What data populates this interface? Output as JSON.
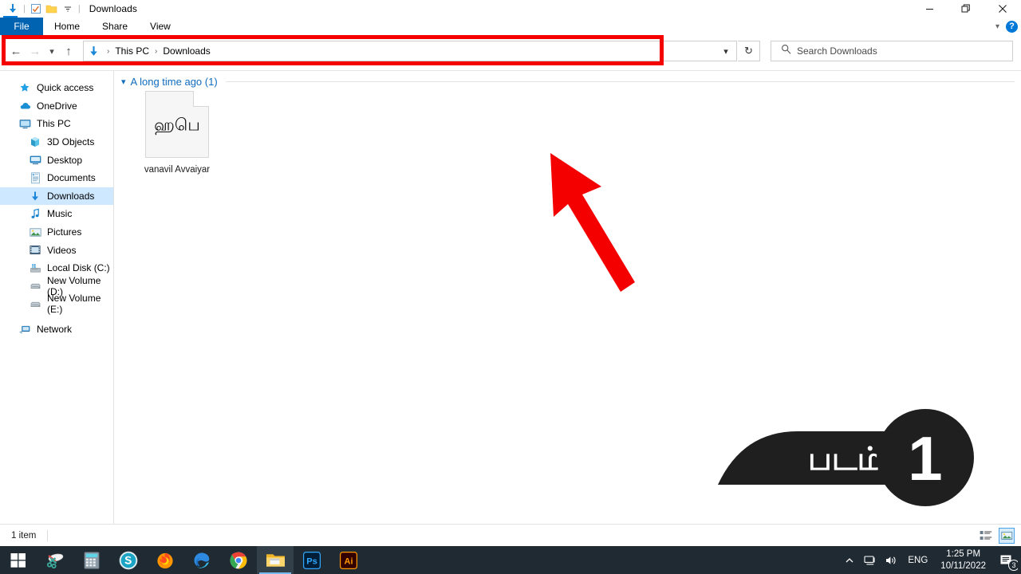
{
  "window": {
    "title": "Downloads",
    "quick_access_icons": [
      "download-arrow-icon",
      "properties-checkbox-icon",
      "new-folder-icon",
      "customize-chevron-icon"
    ],
    "controls": {
      "minimize": "─",
      "restore": "❐",
      "close": "✕"
    }
  },
  "ribbon": {
    "tabs": [
      {
        "label": "File",
        "active": true
      },
      {
        "label": "Home",
        "active": false
      },
      {
        "label": "Share",
        "active": false
      },
      {
        "label": "View",
        "active": false
      }
    ],
    "collapse_icon": "ˇ",
    "help_label": "?"
  },
  "navigation": {
    "back_icon": "←",
    "forward_icon": "→",
    "recent_icon": "ˇ",
    "up_icon": "↑",
    "breadcrumbs": [
      "This PC",
      "Downloads"
    ],
    "breadcrumb_sep": "›",
    "dropdown_icon": "ˇ",
    "refresh_icon": "↻"
  },
  "search": {
    "placeholder": "Search Downloads",
    "icon": "search-icon"
  },
  "sidebar": {
    "items": [
      {
        "label": "Quick access",
        "icon": "star-icon",
        "level": 0,
        "selected": false
      },
      {
        "label": "OneDrive",
        "icon": "cloud-icon",
        "level": 0,
        "selected": false
      },
      {
        "label": "This PC",
        "icon": "monitor-icon",
        "level": 0,
        "selected": false
      },
      {
        "label": "3D Objects",
        "icon": "cube-icon",
        "level": 1,
        "selected": false
      },
      {
        "label": "Desktop",
        "icon": "desktop-icon",
        "level": 1,
        "selected": false
      },
      {
        "label": "Documents",
        "icon": "documents-icon",
        "level": 1,
        "selected": false
      },
      {
        "label": "Downloads",
        "icon": "download-arrow-icon",
        "level": 1,
        "selected": true
      },
      {
        "label": "Music",
        "icon": "music-note-icon",
        "level": 1,
        "selected": false
      },
      {
        "label": "Pictures",
        "icon": "picture-icon",
        "level": 1,
        "selected": false
      },
      {
        "label": "Videos",
        "icon": "video-icon",
        "level": 1,
        "selected": false
      },
      {
        "label": "Local Disk (C:)",
        "icon": "system-drive-icon",
        "level": 1,
        "selected": false
      },
      {
        "label": "New Volume (D:)",
        "icon": "drive-icon",
        "level": 1,
        "selected": false
      },
      {
        "label": "New Volume (E:)",
        "icon": "drive-icon",
        "level": 1,
        "selected": false
      },
      {
        "label": "Network",
        "icon": "network-icon",
        "level": 0,
        "selected": false
      }
    ]
  },
  "main": {
    "group": {
      "chevron": "⌄",
      "label": "A long time ago (1)"
    },
    "files": [
      {
        "name": "vanavil Avvaiyar",
        "preview_text": "ஹபெ",
        "icon": "font-file-icon"
      }
    ]
  },
  "annotations": {
    "arrow": {
      "color": "#f40000",
      "name": "red-pointer-arrow"
    },
    "highlight_box": {
      "color": "#f40000",
      "name": "address-bar-highlight"
    },
    "badge": {
      "text": "படம்",
      "number": "1",
      "color": "#1f1f1f"
    }
  },
  "status": {
    "item_count": "1 item",
    "views": [
      {
        "name": "details-view",
        "active": false
      },
      {
        "name": "large-icons-view",
        "active": true
      }
    ]
  },
  "taskbar": {
    "items": [
      {
        "name": "start-button",
        "active": false
      },
      {
        "name": "snipping-tool",
        "active": false
      },
      {
        "name": "calculator",
        "active": false
      },
      {
        "name": "skype",
        "active": false
      },
      {
        "name": "firefox",
        "active": false
      },
      {
        "name": "microsoft-edge",
        "active": false
      },
      {
        "name": "google-chrome",
        "active": false
      },
      {
        "name": "file-explorer",
        "active": true
      },
      {
        "name": "adobe-photoshop",
        "label": "Ps",
        "active": false
      },
      {
        "name": "adobe-illustrator",
        "label": "Ai",
        "active": false
      }
    ],
    "tray": {
      "show_hidden_icon": "∧",
      "network_icon": "network-icon",
      "volume_icon": "volume-icon",
      "language": "ENG",
      "time": "1:25 PM",
      "date": "10/11/2022",
      "notification_count": "3"
    }
  }
}
